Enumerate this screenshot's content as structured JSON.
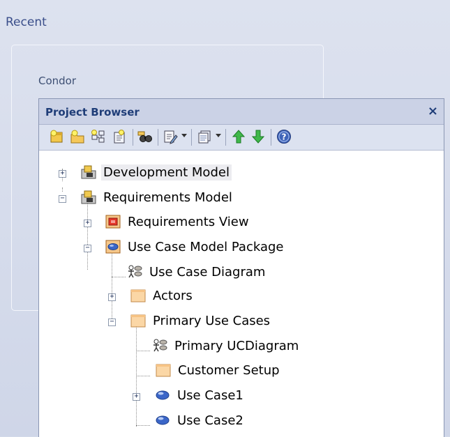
{
  "recent_label": "Recent",
  "condor_label": "Condor",
  "panel": {
    "title": "Project Browser",
    "close_glyph": "×"
  },
  "toolbar": {
    "icons": [
      "new-model-icon",
      "new-package-icon",
      "new-diagram-icon",
      "new-element-icon",
      "find-icon",
      "edit-notes-icon",
      "view-options-icon",
      "move-up-icon",
      "move-down-icon",
      "help-icon"
    ]
  },
  "tree": {
    "development_model": "Development Model",
    "requirements_model": "Requirements Model",
    "requirements_view": "Requirements View",
    "use_case_model_package": "Use Case Model Package",
    "use_case_diagram": "Use Case Diagram",
    "actors": "Actors",
    "primary_use_cases": "Primary Use Cases",
    "primary_uc_diagram": "Primary UCDiagram",
    "customer_setup": "Customer Setup",
    "use_case1": "Use Case1",
    "use_case2": "Use Case2"
  },
  "expanders": {
    "plus": "+",
    "minus": "−"
  },
  "colors": {
    "accent": "#1f3d78",
    "background": "#d4daea"
  }
}
